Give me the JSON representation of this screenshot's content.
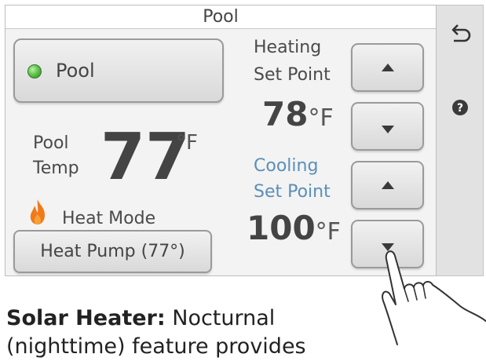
{
  "panel": {
    "title": "Pool",
    "pool_button_label": "Pool",
    "pool_temp_label_line1": "Pool",
    "pool_temp_label_line2": "Temp",
    "pool_temp_value": "77",
    "pool_temp_unit": "°F",
    "heat_mode_label": "Heat Mode",
    "heat_mode_value": "Heat Pump (77°)",
    "heating_label_line1": "Heating",
    "heating_label_line2": "Set Point",
    "heating_value": "78",
    "heating_unit": "°F",
    "cooling_label_line1": "Cooling",
    "cooling_label_line2": "Set Point",
    "cooling_value": "100",
    "cooling_unit": "°F"
  },
  "sidebar": {
    "back_icon": "back-arrow-icon",
    "help_icon": "help-icon"
  },
  "caption": {
    "bold": "Solar Heater:",
    "rest": "Nocturnal",
    "line2": "(nighttime) feature provides"
  },
  "colors": {
    "status_led": "#5fc74a",
    "flame": "#f07a1a",
    "cooling_text": "#5a8fb8"
  }
}
